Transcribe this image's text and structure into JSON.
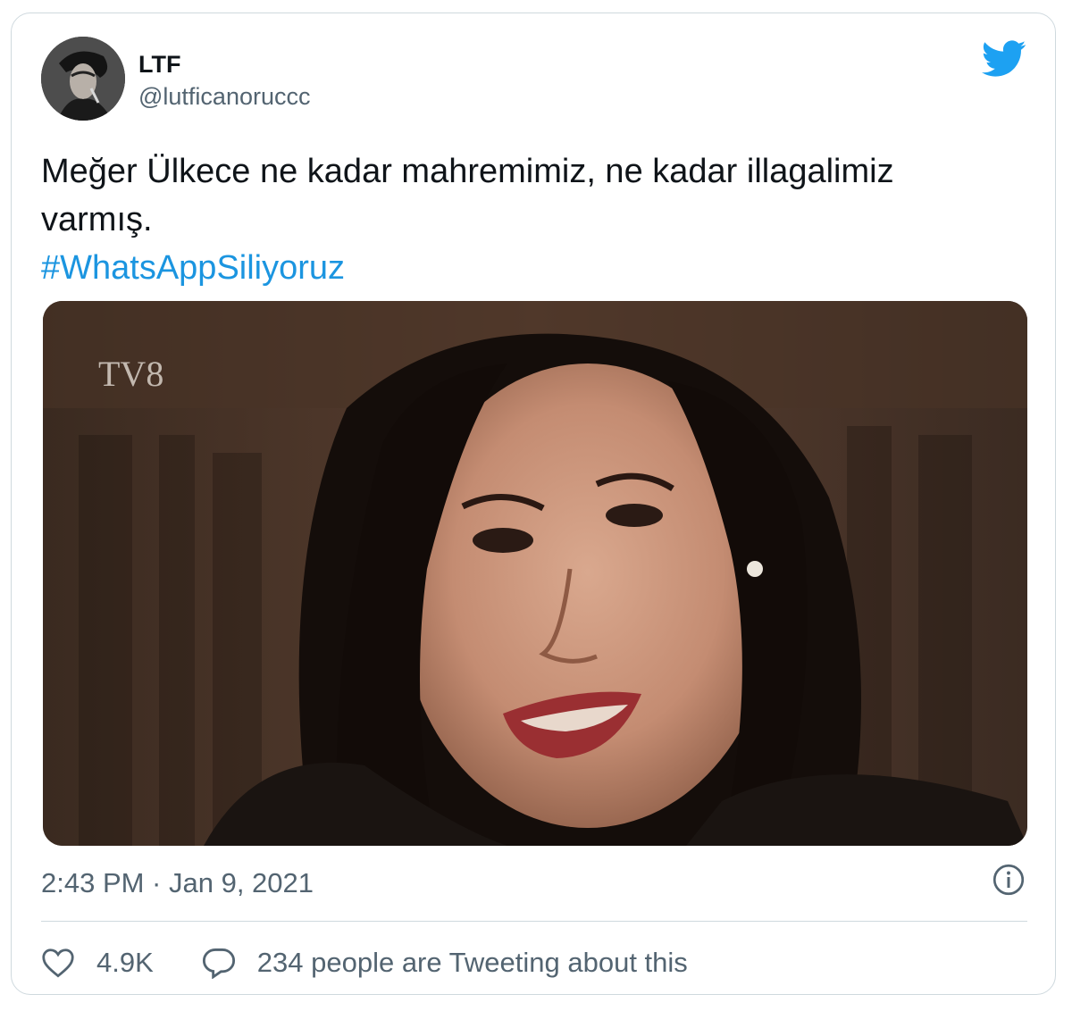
{
  "author": {
    "display_name": "LTF",
    "handle": "@lutficanoruccc",
    "avatar_icon": "profile-photo"
  },
  "brand": {
    "logo_icon": "twitter-bird-icon",
    "accent_color": "#1da1f2",
    "hashtag_color": "#1b95e0"
  },
  "tweet": {
    "text_line1": "Meğer Ülkece ne kadar mahremimiz, ne kadar illagalimiz",
    "text_line2": "varmış.",
    "hashtag": "#WhatsAppSiliyoruz"
  },
  "media": {
    "channel_watermark": "TV8",
    "description_icon": "video-still-image"
  },
  "meta": {
    "timestamp": "2:43 PM · Jan 9, 2021",
    "info_icon": "info-icon"
  },
  "actions": {
    "like_icon": "heart-icon",
    "like_count": "4.9K",
    "reply_icon": "speech-bubble-icon",
    "discussion_text": "234 people are Tweeting about this"
  }
}
